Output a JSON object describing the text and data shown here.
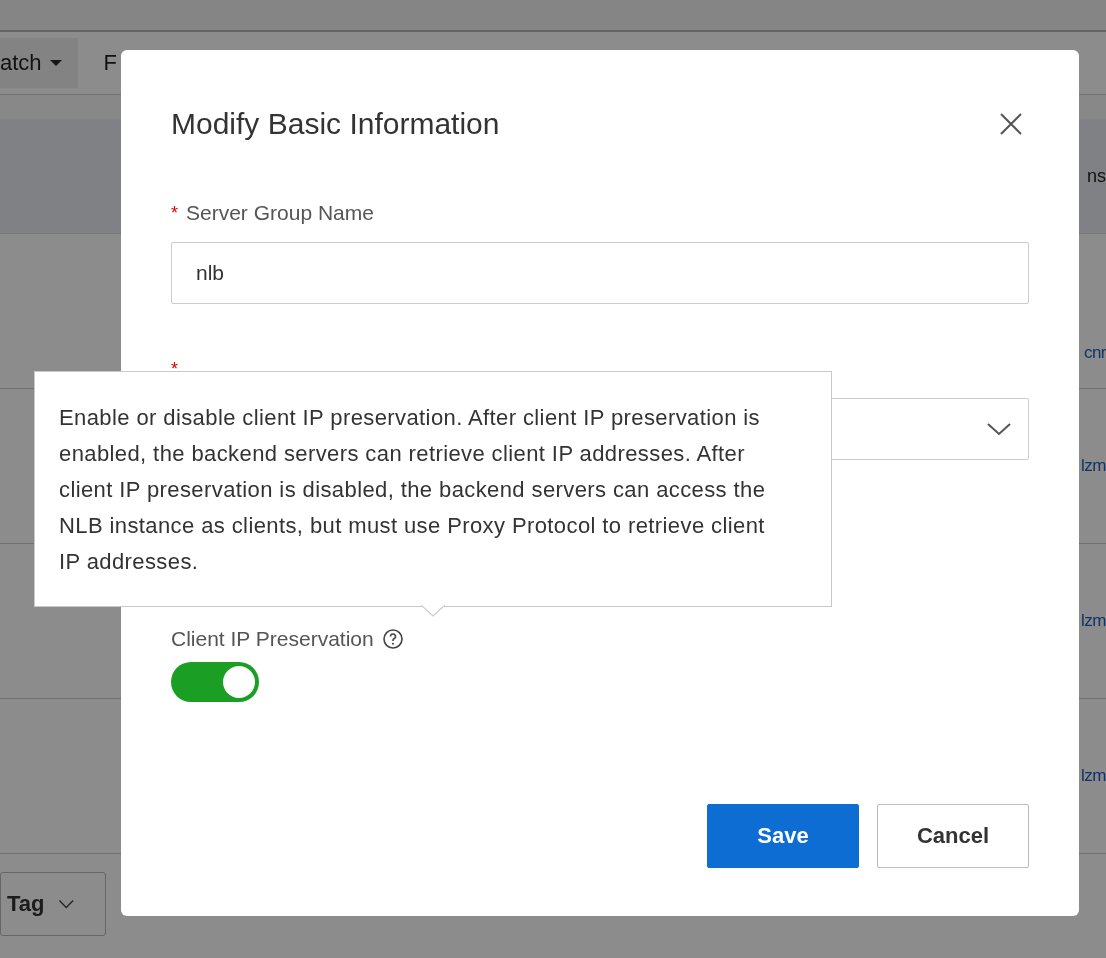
{
  "background": {
    "toolbar": {
      "batch_button": "atch",
      "filter_text": "F"
    },
    "table": {
      "header_text": "ns",
      "links": [
        "cnr",
        "lzm",
        "lzm",
        "lzm"
      ]
    },
    "tag_select": "Tag"
  },
  "dialog": {
    "title": "Modify Basic Information",
    "fields": [
      {
        "kind": "input",
        "label": "Server Group Name",
        "required_mark": "*",
        "value": "nlb"
      },
      {
        "kind": "select",
        "required_mark": "*"
      },
      {
        "kind": "toggle",
        "label": "Client IP Preservation",
        "on": true
      }
    ],
    "tooltip": "Enable or disable client IP preservation. After client IP preservation is enabled, the backend servers can retrieve client IP addresses. After client IP preservation is disabled, the backend servers can access the NLB instance as clients, but must use Proxy Protocol to retrieve client IP addresses.",
    "buttons": [
      {
        "label": "Save",
        "primary": true
      },
      {
        "label": "Cancel",
        "primary": false
      }
    ]
  }
}
